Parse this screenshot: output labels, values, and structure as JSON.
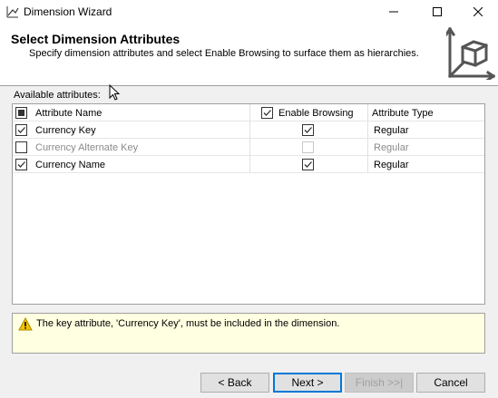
{
  "window": {
    "title": "Dimension Wizard",
    "icons": {
      "app": "wizard-icon",
      "minimize": "minimize-icon",
      "maximize": "maximize-icon",
      "close": "close-icon"
    }
  },
  "header": {
    "title": "Select Dimension Attributes",
    "subtitle": "Specify dimension attributes and select Enable Browsing to surface them as hierarchies.",
    "icon": "dimension-cube-icon"
  },
  "available_label": "Available attributes:",
  "grid": {
    "columns": {
      "name": "Attribute Name",
      "browsing": "Enable Browsing",
      "type": "Attribute Type"
    },
    "header_select_state": "indeterminate",
    "header_browsing_checked": true,
    "rows": [
      {
        "name": "Currency Key",
        "selected": true,
        "browsing": true,
        "type": "Regular",
        "enabled": true
      },
      {
        "name": "Currency Alternate Key",
        "selected": false,
        "browsing": false,
        "type": "Regular",
        "enabled": false
      },
      {
        "name": "Currency Name",
        "selected": true,
        "browsing": true,
        "type": "Regular",
        "enabled": true
      }
    ]
  },
  "message": {
    "icon": "warning-icon",
    "text": "The key attribute, 'Currency Key', must be included in the dimension."
  },
  "buttons": {
    "back": "< Back",
    "next": "Next >",
    "finish": "Finish >>|",
    "cancel": "Cancel"
  },
  "colors": {
    "warning_background": "#ffffe1",
    "primary_border": "#0078d7",
    "panel_background": "#f0f0f0"
  }
}
